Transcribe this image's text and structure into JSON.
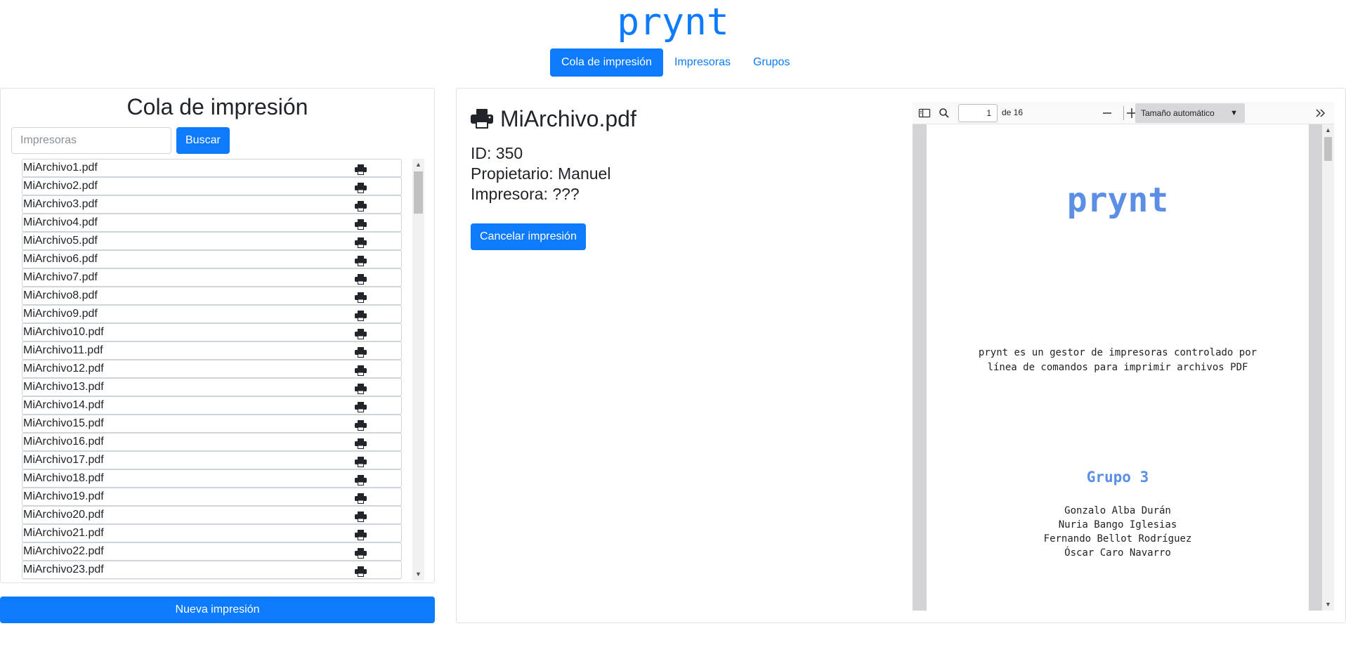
{
  "header": {
    "brand": "prynt"
  },
  "nav": {
    "tabs": [
      "Cola de impresión",
      "Impresoras",
      "Grupos"
    ]
  },
  "queue": {
    "title": "Cola de impresión",
    "search_placeholder": "Impresoras",
    "search_button": "Buscar",
    "files": [
      "MiArchivo1.pdf",
      "MiArchivo2.pdf",
      "MiArchivo3.pdf",
      "MiArchivo4.pdf",
      "MiArchivo5.pdf",
      "MiArchivo6.pdf",
      "MiArchivo7.pdf",
      "MiArchivo8.pdf",
      "MiArchivo9.pdf",
      "MiArchivo10.pdf",
      "MiArchivo11.pdf",
      "MiArchivo12.pdf",
      "MiArchivo13.pdf",
      "MiArchivo14.pdf",
      "MiArchivo15.pdf",
      "MiArchivo16.pdf",
      "MiArchivo17.pdf",
      "MiArchivo18.pdf",
      "MiArchivo19.pdf",
      "MiArchivo20.pdf",
      "MiArchivo21.pdf",
      "MiArchivo22.pdf",
      "MiArchivo23.pdf"
    ],
    "new_button": "Nueva impresión"
  },
  "job": {
    "title": "MiArchivo.pdf",
    "id_line": "ID: 350",
    "owner_line": "Propietario: Manuel",
    "printer_line": "Impresora: ???",
    "cancel_button": "Cancelar impresión"
  },
  "viewer": {
    "page_number": "1",
    "page_of": "de 16",
    "zoom": "Tamaño automático",
    "doc": {
      "brand": "prynt",
      "desc_line1": "prynt es un gestor de impresoras controlado por",
      "desc_line2": "línea de comandos para imprimir archivos PDF",
      "group": "Grupo 3",
      "members": [
        "Gonzalo Alba Durán",
        "Nuria Bango Iglesias",
        "Fernando Bellot Rodríguez",
        "Óscar Caro Navarro"
      ]
    }
  },
  "icons": {
    "job_icon": "printer-icon",
    "row_icon": "printer-icon"
  },
  "colors": {
    "accent": "#0d7bfb",
    "pdf_accent": "#5b8fe6"
  }
}
